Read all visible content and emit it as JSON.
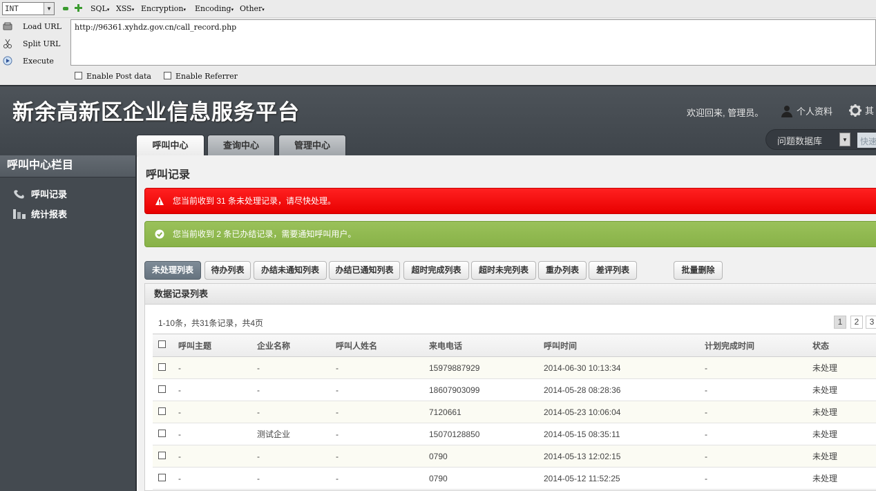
{
  "hackbar": {
    "select_value": "INT",
    "menus": [
      "SQL",
      "XSS",
      "Encryption",
      "Encoding",
      "Other"
    ],
    "load_url": "Load URL",
    "split_url": "Split URL",
    "execute": "Execute",
    "url": "http://96361.xyhdz.gov.cn/call_record.php",
    "enable_post": "Enable Post data",
    "enable_referrer": "Enable Referrer"
  },
  "header": {
    "site_title": "新余高新区企业信息服务平台",
    "welcome": "欢迎回来, 管理员。",
    "profile": "个人资料",
    "other": "其",
    "search_select": "问题数据库",
    "search_placeholder": "快速",
    "tabs": [
      "呼叫中心",
      "查询中心",
      "管理中心"
    ]
  },
  "sidebar": {
    "title": "呼叫中心栏目",
    "items": [
      "呼叫记录",
      "统计报表"
    ]
  },
  "content": {
    "page_title": "呼叫记录",
    "alert_red": "您当前收到 31 条未处理记录，请尽快处理。",
    "alert_green": "您当前收到 2 条已办结记录，需要通知呼叫用户。",
    "filters": [
      "未处理列表",
      "待办列表",
      "办结未通知列表",
      "办结已通知列表",
      "超时完成列表",
      "超时未完列表",
      "重办列表",
      "差评列表"
    ],
    "batch_delete": "批量删除",
    "panel_title": "数据记录列表",
    "pager_info": "1-10条，共31条记录，共4页",
    "pages": [
      "1",
      "2",
      "3"
    ],
    "columns": [
      "呼叫主题",
      "企业名称",
      "呼叫人姓名",
      "来电电话",
      "呼叫时间",
      "计划完成时间",
      "状态"
    ],
    "rows": [
      [
        "-",
        "-",
        "-",
        "15979887929",
        "2014-06-30 10:13:34",
        "-",
        "未处理"
      ],
      [
        "-",
        "-",
        "-",
        "18607903099",
        "2014-05-28 08:28:36",
        "-",
        "未处理"
      ],
      [
        "-",
        "-",
        "-",
        "7120661",
        "2014-05-23 10:06:04",
        "-",
        "未处理"
      ],
      [
        "-",
        "测试企业",
        "-",
        "15070128850",
        "2014-05-15 08:35:11",
        "-",
        "未处理"
      ],
      [
        "-",
        "-",
        "-",
        "0790",
        "2014-05-13 12:02:15",
        "-",
        "未处理"
      ],
      [
        "-",
        "-",
        "-",
        "0790",
        "2014-05-12 11:52:25",
        "-",
        "未处理"
      ]
    ]
  }
}
